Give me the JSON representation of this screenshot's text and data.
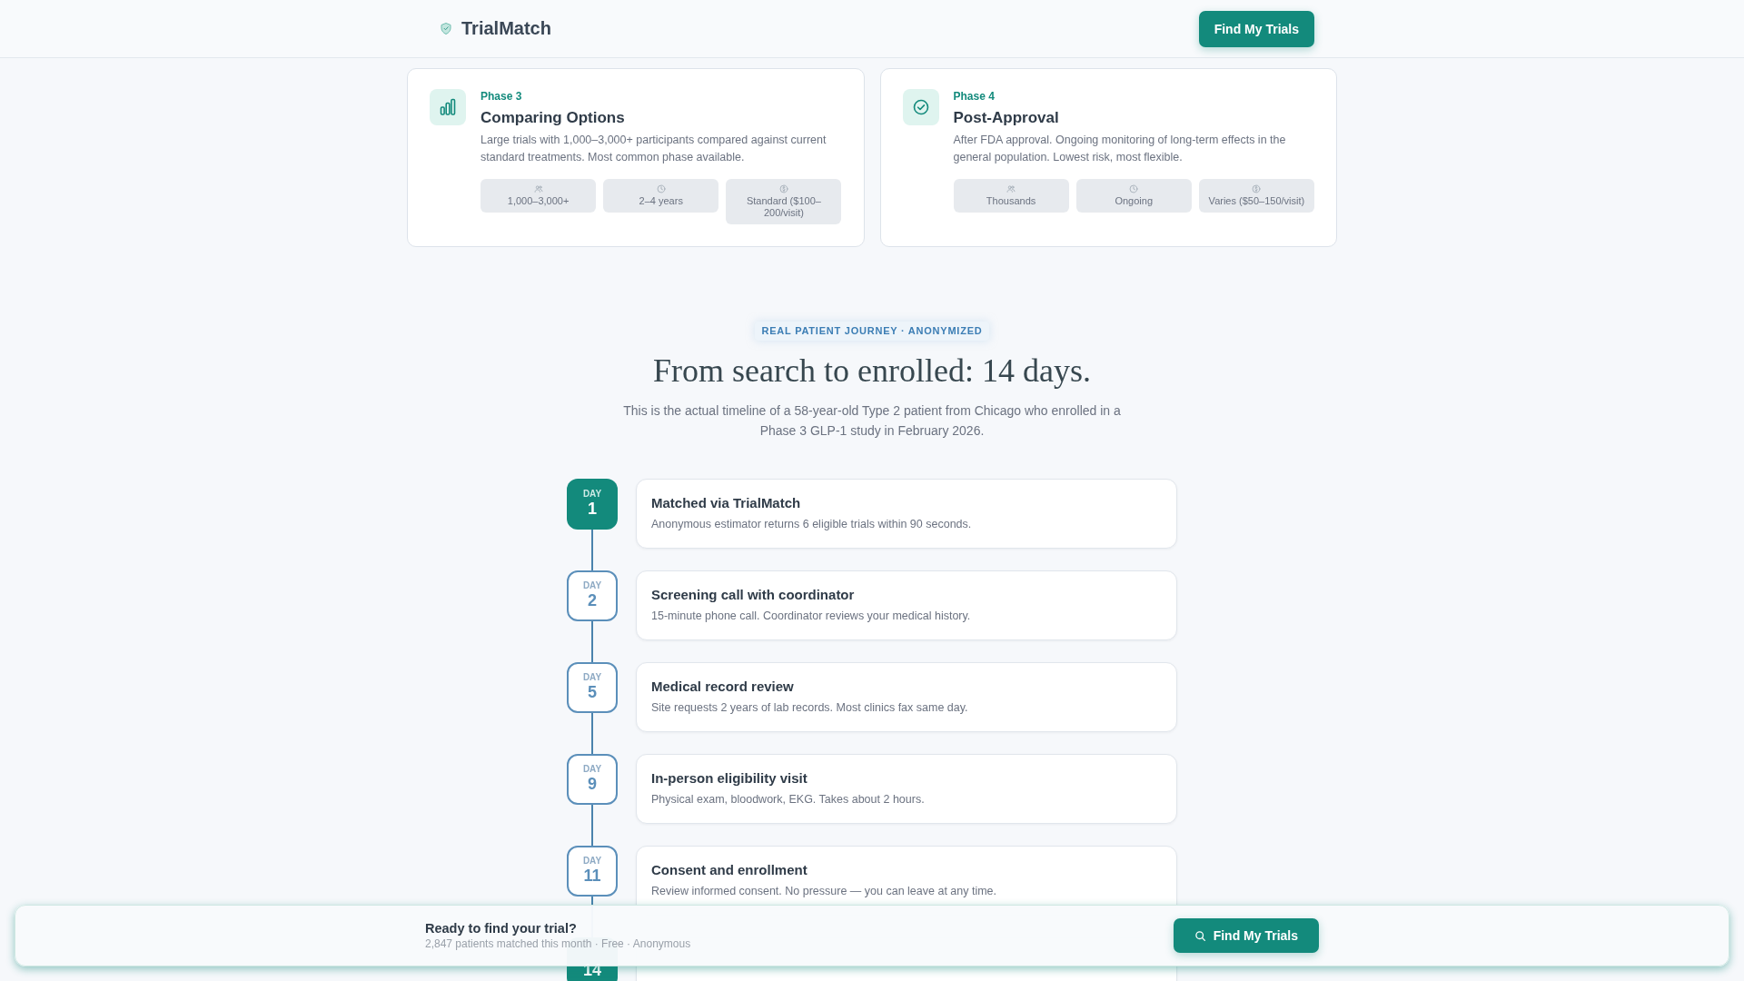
{
  "header": {
    "logo": "TrialMatch",
    "button": "Find My Trials"
  },
  "phases": [
    {
      "label": "Phase 3",
      "title": "Comparing Options",
      "description": "Large trials with 1,000–3,000+ participants compared against current standard treatments. Most common phase available.",
      "stats": [
        "1,000–3,000+",
        "2–4 years",
        "Standard ($100–200/visit)"
      ]
    },
    {
      "label": "Phase 4",
      "title": "Post-Approval",
      "description": "After FDA approval. Ongoing monitoring of long-term effects in the general population. Lowest risk, most flexible.",
      "stats": [
        "Thousands",
        "Ongoing",
        "Varies ($50–150/visit)"
      ]
    }
  ],
  "journey": {
    "badge": "REAL PATIENT JOURNEY · ANONYMIZED",
    "title": "From search to enrolled: 14 days.",
    "intro": "This is the actual timeline of a 58-year-old Type 2 patient from Chicago who enrolled in a Phase 3 GLP-1 study in February 2026.",
    "steps": [
      {
        "label": "DAY",
        "day": "1",
        "title": "Matched via TrialMatch",
        "description": "Anonymous estimator returns 6 eligible trials within 90 seconds.",
        "highlighted": true
      },
      {
        "label": "DAY",
        "day": "2",
        "title": "Screening call with coordinator",
        "description": "15-minute phone call. Coordinator reviews your medical history.",
        "highlighted": false
      },
      {
        "label": "DAY",
        "day": "5",
        "title": "Medical record review",
        "description": "Site requests 2 years of lab records. Most clinics fax same day.",
        "highlighted": false
      },
      {
        "label": "DAY",
        "day": "9",
        "title": "In-person eligibility visit",
        "description": "Physical exam, bloodwork, EKG. Takes about 2 hours.",
        "highlighted": false
      },
      {
        "label": "DAY",
        "day": "11",
        "title": "Consent and enrollment",
        "description": "Review informed consent. No pressure — you can leave at any time.",
        "highlighted": false
      },
      {
        "day": "14",
        "highlighted": true
      }
    ]
  },
  "cta_bar": {
    "title": "Ready to find your trial?",
    "subtitle": "2,847 patients matched this month · Free · Anonymous",
    "button": "Find My Trials"
  }
}
